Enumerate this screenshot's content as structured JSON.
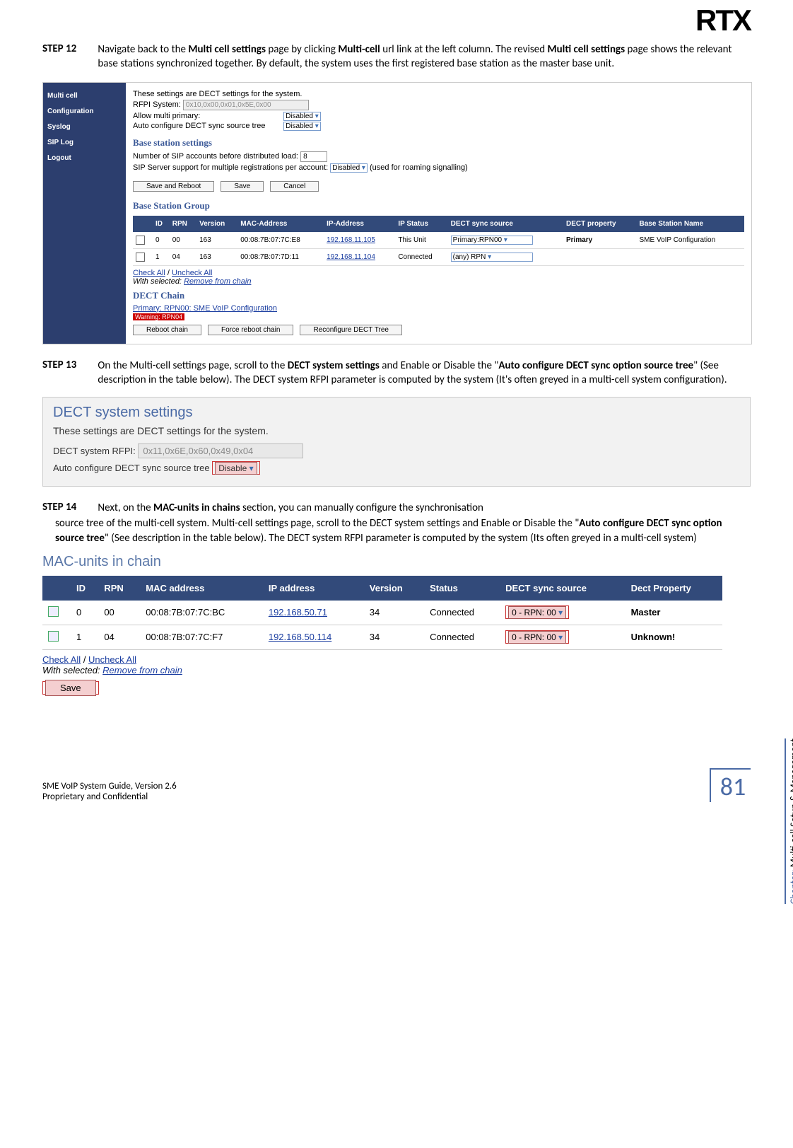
{
  "logo": "RTX",
  "step12": {
    "label": "STEP 12",
    "text_1": "Navigate back to the ",
    "bold_1": "Multi cell settings",
    "text_2": " page by clicking ",
    "bold_2": "Multi-cell",
    "text_3": " url link at the left column. The revised ",
    "bold_3": "Multi cell settings",
    "text_4": " page shows the relevant base stations synchronized together. By default, the system uses the first registered base station as the master base unit."
  },
  "shot1": {
    "sidebar": [
      "Multi cell",
      "Configuration",
      "Syslog",
      "SIP Log",
      "Logout"
    ],
    "topline": "These settings are DECT settings for the system.",
    "rfpi_label": "RFPI System:",
    "rfpi_value": "0x10,0x00,0x01,0x5E,0x00",
    "allow_label": "Allow multi primary:",
    "allow_value": "Disabled",
    "auto_label": "Auto configure DECT sync source tree",
    "auto_value": "Disabled",
    "bss_header": "Base station settings",
    "sip_acc_label": "Number of SIP accounts before distributed load:",
    "sip_acc_value": "8",
    "sip_multi_label": "SIP Server support for multiple registrations per account:",
    "sip_multi_value": "Disabled",
    "sip_multi_hint": "(used for roaming signalling)",
    "btns": [
      "Save and Reboot",
      "Save",
      "Cancel"
    ],
    "bsg_header": "Base Station Group",
    "bsg_cols": [
      "",
      "ID",
      "RPN",
      "Version",
      "MAC-Address",
      "IP-Address",
      "IP Status",
      "DECT sync source",
      "DECT property",
      "Base Station Name"
    ],
    "bsg_rows": [
      {
        "id": "0",
        "rpn": "00",
        "ver": "163",
        "mac": "00:08:7B:07:7C:E8",
        "ip": "192.168.11.105",
        "ipstat": "This Unit",
        "sync": "Primary:RPN00",
        "prop": "Primary",
        "name": "SME VoIP Configuration"
      },
      {
        "id": "1",
        "rpn": "04",
        "ver": "163",
        "mac": "00:08:7B:07:7D:11",
        "ip": "192.168.11.104",
        "ipstat": "Connected",
        "sync": "(any) RPN",
        "prop": "",
        "name": ""
      }
    ],
    "check_all": "Check All",
    "uncheck_all": "Uncheck All",
    "withsel": "With selected:",
    "remove": "Remove from chain",
    "dect_chain": "DECT Chain",
    "primary": "Primary: RPN00: SME VoIP Configuration",
    "warning": "Warning: RPN04",
    "btns2": [
      "Reboot chain",
      "Force reboot chain",
      "Reconfigure DECT Tree"
    ]
  },
  "step13": {
    "label": "STEP 13",
    "t1": "On the Multi-cell settings page, scroll to the ",
    "b1": "DECT system settings",
    "t2": " and Enable or Disable the \"",
    "b2": "Auto configure DECT sync option source tree",
    "t3": "\" (See description in the table below). The DECT system RFPI parameter is computed by the system (It's often greyed in a multi-cell system configuration)."
  },
  "shot2": {
    "title": "DECT system settings",
    "desc": "These settings are DECT settings for the system.",
    "rfpi_label": "DECT system RFPI:",
    "rfpi_value": "0x11,0x6E,0x60,0x49,0x04",
    "auto_label": "Auto configure DECT sync source tree",
    "auto_value": "Disable"
  },
  "step14": {
    "label": "STEP 14",
    "t1": "Next, on the ",
    "b1": "MAC-units in chains",
    "t2": " section, you can manually configure the synchronisation source tree of the multi-cell system. Multi-cell settings page, scroll to the DECT system settings and Enable or Disable the \"",
    "b2": "Auto configure DECT sync option source tree",
    "t3": "\" (See description in the table below). The DECT system RFPI parameter is computed by the system (Its often greyed in a multi-cell system)"
  },
  "shot3": {
    "title": "MAC-units in chain",
    "cols": [
      "",
      "ID",
      "RPN",
      "MAC address",
      "IP address",
      "Version",
      "Status",
      "DECT sync source",
      "Dect Property"
    ],
    "rows": [
      {
        "id": "0",
        "rpn": "00",
        "mac": "00:08:7B:07:7C:BC",
        "ip": "192.168.50.71",
        "ver": "34",
        "stat": "Connected",
        "sync": "0 - RPN: 00",
        "prop": "Master"
      },
      {
        "id": "1",
        "rpn": "04",
        "mac": "00:08:7B:07:7C:F7",
        "ip": "192.168.50.114",
        "ver": "34",
        "stat": "Connected",
        "sync": "0 - RPN: 00",
        "prop": "Unknown!"
      }
    ],
    "check_all": "Check All",
    "uncheck_all": "Uncheck All",
    "withsel": "With selected:",
    "remove": "Remove from chain",
    "save": "Save"
  },
  "chapter_label": "Chapter:",
  "chapter_text": " Multi-cell Setup & Management",
  "footer1": "SME VoIP System Guide, Version 2.6",
  "footer2": "Proprietary and Confidential",
  "pagenum": "81"
}
